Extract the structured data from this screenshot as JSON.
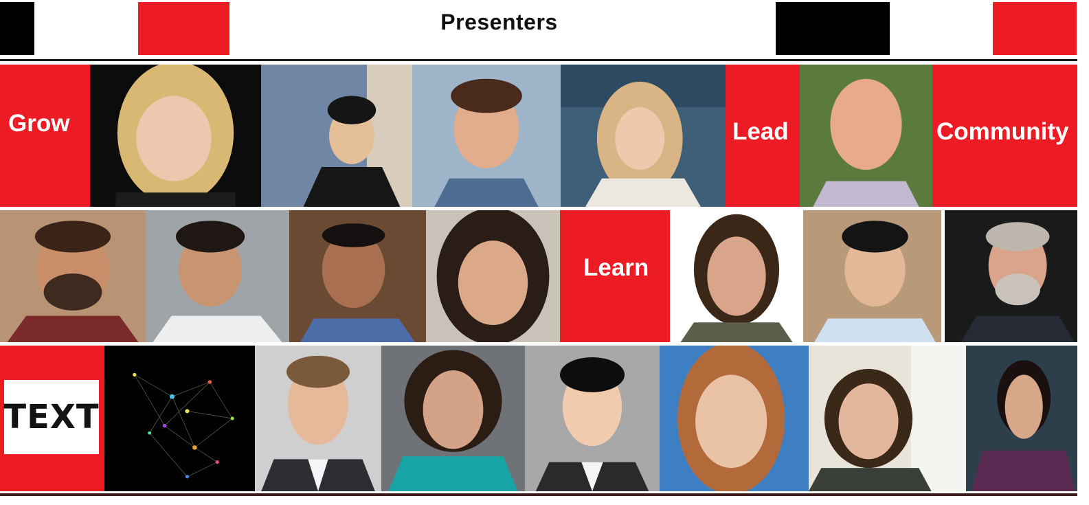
{
  "header": {
    "title": "Presenters"
  },
  "labels": {
    "grow": "Grow",
    "lead": "Lead",
    "community": "Community",
    "learn": "Learn",
    "text_tile": "TEXT"
  },
  "colors": {
    "accent_red": "#ed1c24",
    "black": "#000000",
    "white": "#ffffff"
  }
}
